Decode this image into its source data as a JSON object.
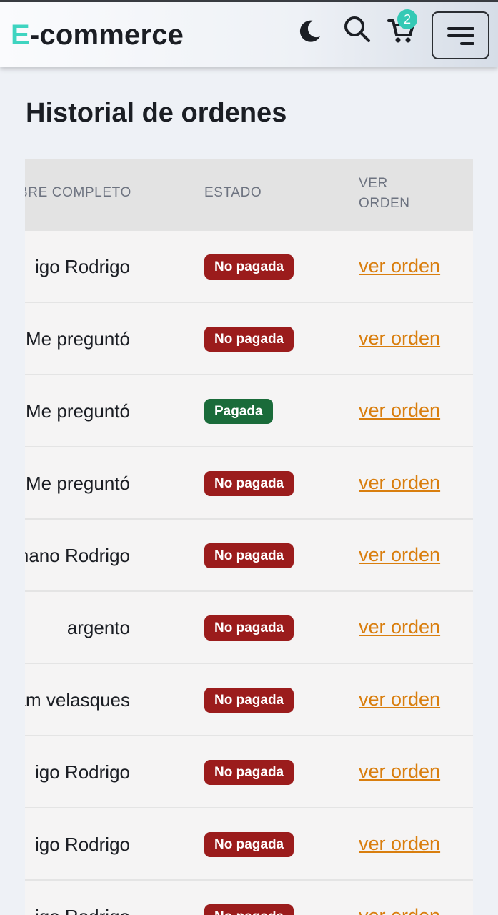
{
  "header": {
    "brand_first": "E",
    "brand_rest": "-commerce",
    "cart_count": "2",
    "icons": [
      "moon-icon",
      "search-icon",
      "cart-icon",
      "menu-icon"
    ],
    "accent_color": "#3fd4c0"
  },
  "page": {
    "title": "Historial de ordenes"
  },
  "table": {
    "columns": [
      "BRE COMPLETO",
      "ESTADO",
      "VER ORDEN"
    ],
    "rows": [
      {
        "name": "igo Rodrigo",
        "status": "No pagada",
        "link": "ver orden"
      },
      {
        "name": "Me preguntó",
        "status": "No pagada",
        "link": "ver orden"
      },
      {
        "name": "Me preguntó",
        "status": "Pagada",
        "link": "ver orden"
      },
      {
        "name": "Me preguntó",
        "status": "No pagada",
        "link": "ver orden"
      },
      {
        "name": "nano Rodrigo",
        "status": "No pagada",
        "link": "ver orden"
      },
      {
        "name": "argento",
        "status": "No pagada",
        "link": "ver orden"
      },
      {
        "name": "am velasques",
        "status": "No pagada",
        "link": "ver orden"
      },
      {
        "name": "igo Rodrigo",
        "status": "No pagada",
        "link": "ver orden"
      },
      {
        "name": "igo Rodrigo",
        "status": "No pagada",
        "link": "ver orden"
      },
      {
        "name": "igo Rodrigo",
        "status": "No pagada",
        "link": "ver orden"
      }
    ],
    "status_colors": {
      "No pagada": "#9b1c1c",
      "Pagada": "#1a6b3a"
    },
    "link_color": "#d97e0e"
  }
}
